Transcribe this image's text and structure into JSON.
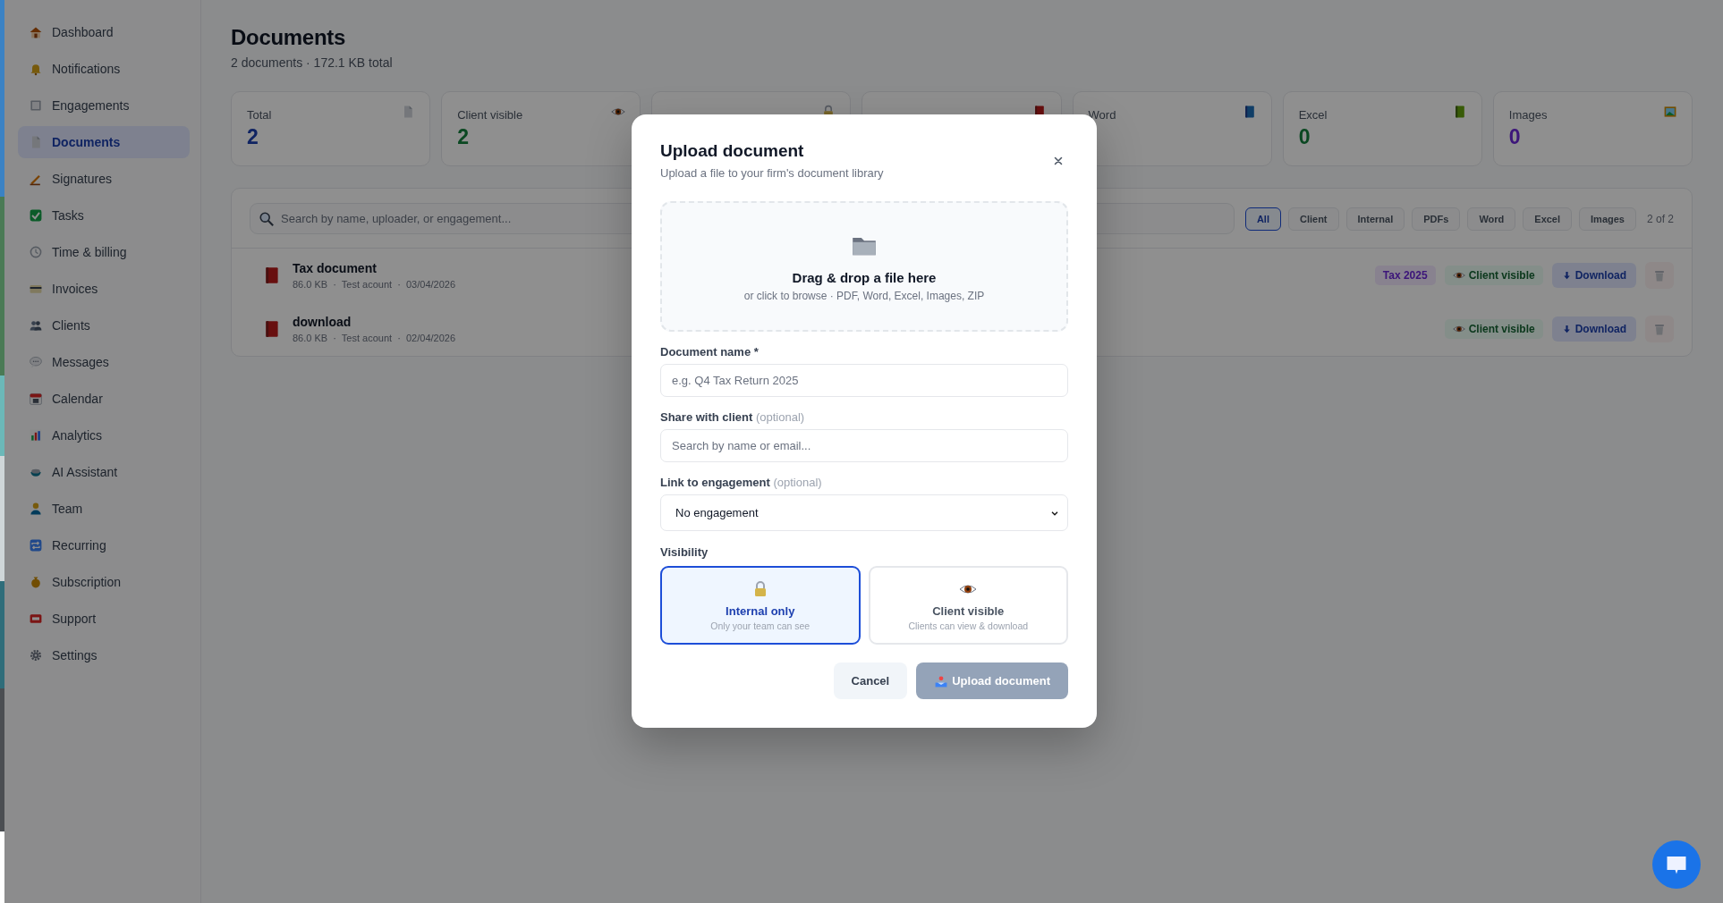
{
  "sidebar": {
    "items": [
      {
        "label": "Dashboard",
        "selected": false
      },
      {
        "label": "Notifications",
        "selected": false
      },
      {
        "label": "Engagements",
        "selected": false
      },
      {
        "label": "Documents",
        "selected": true
      },
      {
        "label": "Signatures",
        "selected": false
      },
      {
        "label": "Tasks",
        "selected": false
      },
      {
        "label": "Time & billing",
        "selected": false
      },
      {
        "label": "Invoices",
        "selected": false
      },
      {
        "label": "Clients",
        "selected": false
      },
      {
        "label": "Messages",
        "selected": false
      },
      {
        "label": "Calendar",
        "selected": false
      },
      {
        "label": "Analytics",
        "selected": false
      },
      {
        "label": "AI Assistant",
        "selected": false
      },
      {
        "label": "Team",
        "selected": false
      },
      {
        "label": "Recurring",
        "selected": false
      },
      {
        "label": "Subscription",
        "selected": false
      },
      {
        "label": "Support",
        "selected": false
      },
      {
        "label": "Settings",
        "selected": false
      }
    ]
  },
  "header": {
    "title": "Documents",
    "subtitle": "2 documents · 172.1 KB total"
  },
  "stats": [
    {
      "kind": "stat",
      "label": "Total",
      "value": "2"
    },
    {
      "kind": "stat",
      "label": "Client visible",
      "value": "2"
    },
    {
      "kind": "covered"
    },
    {
      "kind": "covered"
    },
    {
      "kind": "stat",
      "label": "Word"
    },
    {
      "kind": "stat",
      "label": "Excel",
      "value": "0"
    },
    {
      "kind": "stat",
      "label": "Images",
      "value": "0"
    }
  ],
  "search": {
    "placeholder": "Search by name, uploader, or engagement..."
  },
  "filters": [
    {
      "label": "All",
      "selected": true
    },
    {
      "label": "Client",
      "selected": false
    },
    {
      "label": "Internal",
      "selected": false
    },
    {
      "label": "PDFs",
      "selected": false
    },
    {
      "label": "Word",
      "selected": false
    },
    {
      "label": "Excel",
      "selected": false
    },
    {
      "label": "Images",
      "selected": false
    }
  ],
  "count": "2 of 2",
  "documents": [
    {
      "name": "Tax document",
      "meta": "86.0 KB  ·  Test acount  ·  03/04/2026",
      "tags": [
        {
          "label": "Tax 2025",
          "kind": "engagement"
        },
        {
          "label": "Client visible",
          "kind": "visibility"
        }
      ],
      "download": "Download"
    },
    {
      "name": "download",
      "meta": "86.0 KB  ·  Test acount  ·  02/04/2026",
      "tags": [
        {
          "label": "Client visible",
          "kind": "visibility"
        }
      ],
      "download": "Download"
    }
  ],
  "modal": {
    "title": "Upload document",
    "subtitle": "Upload a file to your firm's document library",
    "dropzone": {
      "title": "Drag & drop a file here",
      "hint": "or click to browse · PDF, Word, Excel, Images, ZIP"
    },
    "fields": [
      {
        "kind": "text",
        "label": "Document name *",
        "placeholder": "e.g. Q4 Tax Return 2025"
      },
      {
        "kind": "text",
        "label": "Share with client",
        "note": "(optional)",
        "placeholder": "Search by name or email..."
      },
      {
        "kind": "select",
        "label": "Link to engagement",
        "note": "(optional)",
        "value": "No engagement"
      }
    ],
    "visibility": {
      "label": "Visibility",
      "options": [
        {
          "title": "Internal only",
          "hint": "Only your team can see",
          "selected": true
        },
        {
          "title": "Client visible",
          "hint": "Clients can view & download",
          "selected": false
        }
      ]
    },
    "buttons": [
      {
        "label": "Cancel",
        "kind": "secondary",
        "disabled": false
      },
      {
        "label": "Upload document",
        "kind": "primary",
        "disabled": true
      }
    ]
  }
}
